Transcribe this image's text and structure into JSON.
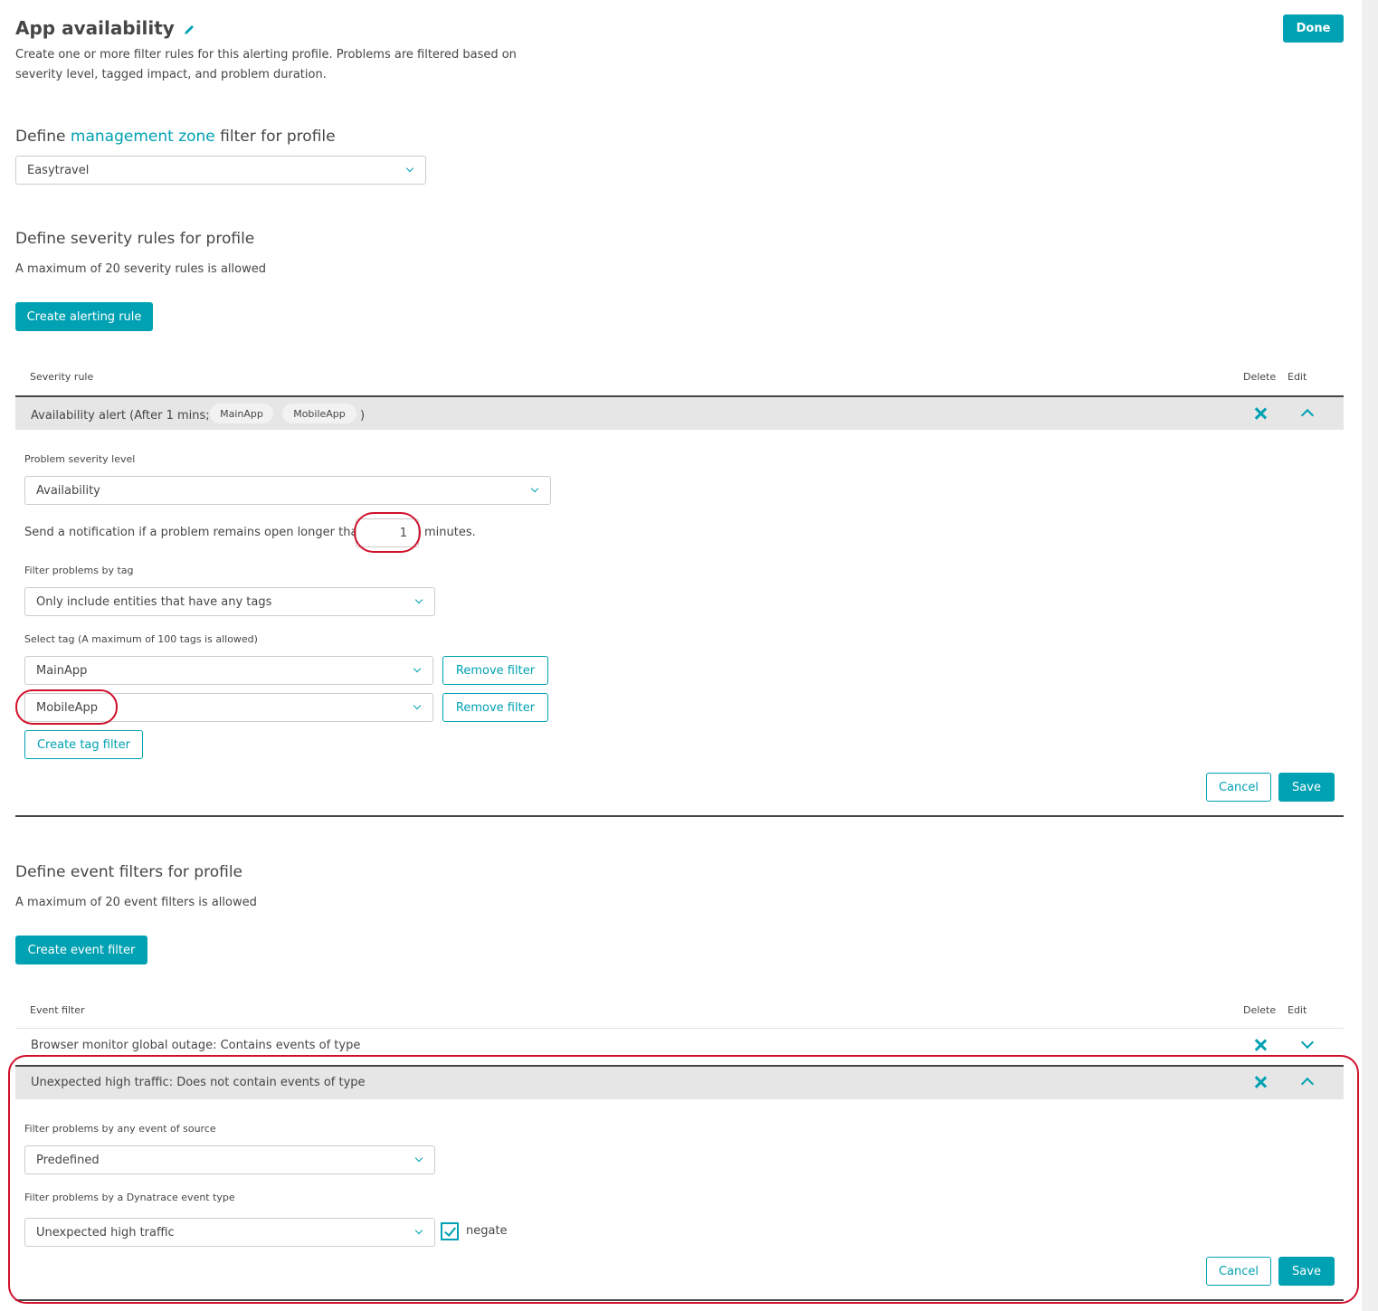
{
  "header": {
    "title": "App availability",
    "description_line1": "Create one or more filter rules for this alerting profile. Problems are filtered based on",
    "description_line2": "severity level, tagged impact, and problem duration.",
    "done_label": "Done"
  },
  "management_zone": {
    "heading_prefix": "Define ",
    "heading_link": "management zone",
    "heading_suffix": " filter for profile",
    "selected": "Easytravel"
  },
  "severity": {
    "heading": "Define severity rules for profile",
    "limit_text": "A maximum of 20 severity rules is allowed",
    "create_label": "Create alerting rule",
    "col_rule": "Severity rule",
    "col_delete": "Delete",
    "col_edit": "Edit",
    "rules": [
      {
        "summary_prefix": "Availability alert (After 1 mins;",
        "chips": [
          "MainApp",
          "MobileApp"
        ],
        "summary_suffix": ")",
        "expanded": true
      }
    ],
    "editor": {
      "severity_label": "Problem severity level",
      "severity_value": "Availability",
      "notify_prefix": "Send a notification if a problem remains open longer than",
      "notify_minutes": "1",
      "notify_suffix": "minutes.",
      "tag_filter_label": "Filter problems by tag",
      "tag_filter_value": "Only include entities that have any tags",
      "select_tag_label": "Select tag (A maximum of 100 tags is allowed)",
      "tags": [
        {
          "value": "MainApp",
          "remove_label": "Remove filter"
        },
        {
          "value": "MobileApp",
          "remove_label": "Remove filter"
        }
      ],
      "create_tag_label": "Create tag filter",
      "cancel_label": "Cancel",
      "save_label": "Save"
    }
  },
  "events": {
    "heading": "Define event filters for profile",
    "limit_text": "A maximum of 20 event filters is allowed",
    "create_label": "Create event filter",
    "col_filter": "Event filter",
    "col_delete": "Delete",
    "col_edit": "Edit",
    "filters": [
      {
        "summary": "Browser monitor global outage: Contains events of type",
        "expanded": false
      },
      {
        "summary": "Unexpected high traffic: Does not contain events of type",
        "expanded": true
      }
    ],
    "editor": {
      "source_label": "Filter problems by any event of source",
      "source_value": "Predefined",
      "type_label": "Filter problems by a Dynatrace event type",
      "type_value": "Unexpected high traffic",
      "negate_label": "negate",
      "negate_checked": true,
      "cancel_label": "Cancel",
      "save_label": "Save"
    }
  },
  "colors": {
    "accent": "#00a1b2",
    "text": "#454646",
    "annotation": "#d0112b",
    "row_bg": "#e6e6e6"
  }
}
